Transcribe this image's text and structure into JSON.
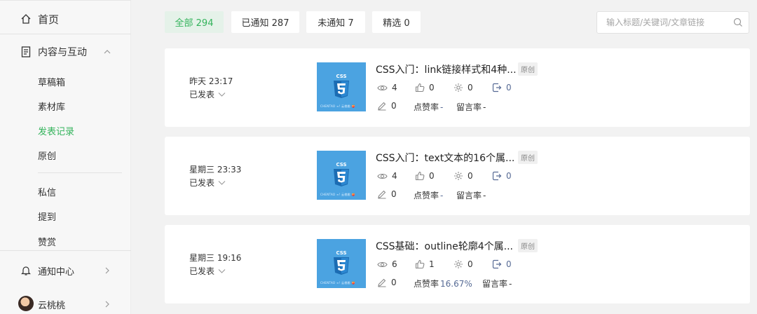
{
  "sidebar": {
    "home": "首页",
    "content": "内容与互动",
    "sub_items": [
      "草稿箱",
      "素材库",
      "发表记录",
      "原创"
    ],
    "items2": [
      "私信",
      "提到",
      "赞赏"
    ],
    "notify": "通知中心",
    "user": "云桃桃"
  },
  "filters": [
    {
      "label": "全部 294"
    },
    {
      "label": "已通知 287"
    },
    {
      "label": "未通知 7"
    },
    {
      "label": "精选 0"
    }
  ],
  "search": {
    "placeholder": "输入标题/关键词/文章链接"
  },
  "colors": {
    "accent": "#33b35b",
    "link": "#576b95",
    "thumb_bg": "#4ba3e1"
  },
  "posts": [
    {
      "time": "昨天 23:17",
      "status": "已发表",
      "thumb_text": "CSS",
      "thumb_caption": "CHENTAO ∞! 云桃桃 🍑",
      "title": "CSS入门：link链接样式和4种...",
      "badge": "原创",
      "views": "4",
      "likes": "0",
      "shares": "0",
      "forwards": "0",
      "edits": "0",
      "like_rate_label": "点赞率",
      "like_rate": "-",
      "comment_rate_label": "留言率",
      "comment_rate": "-"
    },
    {
      "time": "星期三 23:33",
      "status": "已发表",
      "thumb_text": "CSS",
      "thumb_caption": "CHENTAO ∞! 云桃桃 🍑",
      "title": "CSS入门：text文本的16个属...",
      "badge": "原创",
      "views": "4",
      "likes": "0",
      "shares": "0",
      "forwards": "0",
      "edits": "0",
      "like_rate_label": "点赞率",
      "like_rate": "-",
      "comment_rate_label": "留言率",
      "comment_rate": "-"
    },
    {
      "time": "星期三 19:16",
      "status": "已发表",
      "thumb_text": "CSS",
      "thumb_caption": "CHENTAO ∞! 云桃桃 🍑",
      "title": "CSS基础：outline轮廓4个属...",
      "badge": "原创",
      "views": "6",
      "likes": "1",
      "shares": "0",
      "forwards": "0",
      "edits": "0",
      "like_rate_label": "点赞率",
      "like_rate": "16.67%",
      "comment_rate_label": "留言率",
      "comment_rate": "-"
    }
  ]
}
